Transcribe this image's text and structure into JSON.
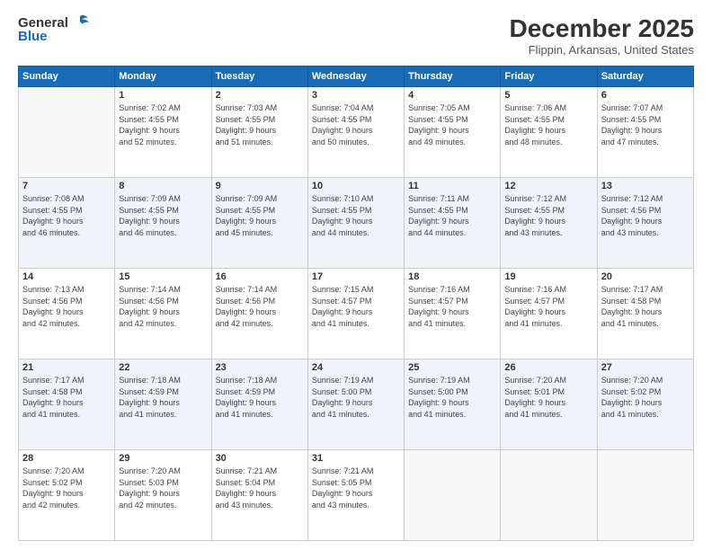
{
  "header": {
    "logo_line1": "General",
    "logo_line2": "Blue",
    "title": "December 2025",
    "subtitle": "Flippin, Arkansas, United States"
  },
  "calendar": {
    "days_of_week": [
      "Sunday",
      "Monday",
      "Tuesday",
      "Wednesday",
      "Thursday",
      "Friday",
      "Saturday"
    ],
    "weeks": [
      [
        {
          "day": "",
          "info": ""
        },
        {
          "day": "1",
          "info": "Sunrise: 7:02 AM\nSunset: 4:55 PM\nDaylight: 9 hours\nand 52 minutes."
        },
        {
          "day": "2",
          "info": "Sunrise: 7:03 AM\nSunset: 4:55 PM\nDaylight: 9 hours\nand 51 minutes."
        },
        {
          "day": "3",
          "info": "Sunrise: 7:04 AM\nSunset: 4:55 PM\nDaylight: 9 hours\nand 50 minutes."
        },
        {
          "day": "4",
          "info": "Sunrise: 7:05 AM\nSunset: 4:55 PM\nDaylight: 9 hours\nand 49 minutes."
        },
        {
          "day": "5",
          "info": "Sunrise: 7:06 AM\nSunset: 4:55 PM\nDaylight: 9 hours\nand 48 minutes."
        },
        {
          "day": "6",
          "info": "Sunrise: 7:07 AM\nSunset: 4:55 PM\nDaylight: 9 hours\nand 47 minutes."
        }
      ],
      [
        {
          "day": "7",
          "info": "Sunrise: 7:08 AM\nSunset: 4:55 PM\nDaylight: 9 hours\nand 46 minutes."
        },
        {
          "day": "8",
          "info": "Sunrise: 7:09 AM\nSunset: 4:55 PM\nDaylight: 9 hours\nand 46 minutes."
        },
        {
          "day": "9",
          "info": "Sunrise: 7:09 AM\nSunset: 4:55 PM\nDaylight: 9 hours\nand 45 minutes."
        },
        {
          "day": "10",
          "info": "Sunrise: 7:10 AM\nSunset: 4:55 PM\nDaylight: 9 hours\nand 44 minutes."
        },
        {
          "day": "11",
          "info": "Sunrise: 7:11 AM\nSunset: 4:55 PM\nDaylight: 9 hours\nand 44 minutes."
        },
        {
          "day": "12",
          "info": "Sunrise: 7:12 AM\nSunset: 4:55 PM\nDaylight: 9 hours\nand 43 minutes."
        },
        {
          "day": "13",
          "info": "Sunrise: 7:12 AM\nSunset: 4:56 PM\nDaylight: 9 hours\nand 43 minutes."
        }
      ],
      [
        {
          "day": "14",
          "info": "Sunrise: 7:13 AM\nSunset: 4:56 PM\nDaylight: 9 hours\nand 42 minutes."
        },
        {
          "day": "15",
          "info": "Sunrise: 7:14 AM\nSunset: 4:56 PM\nDaylight: 9 hours\nand 42 minutes."
        },
        {
          "day": "16",
          "info": "Sunrise: 7:14 AM\nSunset: 4:56 PM\nDaylight: 9 hours\nand 42 minutes."
        },
        {
          "day": "17",
          "info": "Sunrise: 7:15 AM\nSunset: 4:57 PM\nDaylight: 9 hours\nand 41 minutes."
        },
        {
          "day": "18",
          "info": "Sunrise: 7:16 AM\nSunset: 4:57 PM\nDaylight: 9 hours\nand 41 minutes."
        },
        {
          "day": "19",
          "info": "Sunrise: 7:16 AM\nSunset: 4:57 PM\nDaylight: 9 hours\nand 41 minutes."
        },
        {
          "day": "20",
          "info": "Sunrise: 7:17 AM\nSunset: 4:58 PM\nDaylight: 9 hours\nand 41 minutes."
        }
      ],
      [
        {
          "day": "21",
          "info": "Sunrise: 7:17 AM\nSunset: 4:58 PM\nDaylight: 9 hours\nand 41 minutes."
        },
        {
          "day": "22",
          "info": "Sunrise: 7:18 AM\nSunset: 4:59 PM\nDaylight: 9 hours\nand 41 minutes."
        },
        {
          "day": "23",
          "info": "Sunrise: 7:18 AM\nSunset: 4:59 PM\nDaylight: 9 hours\nand 41 minutes."
        },
        {
          "day": "24",
          "info": "Sunrise: 7:19 AM\nSunset: 5:00 PM\nDaylight: 9 hours\nand 41 minutes."
        },
        {
          "day": "25",
          "info": "Sunrise: 7:19 AM\nSunset: 5:00 PM\nDaylight: 9 hours\nand 41 minutes."
        },
        {
          "day": "26",
          "info": "Sunrise: 7:20 AM\nSunset: 5:01 PM\nDaylight: 9 hours\nand 41 minutes."
        },
        {
          "day": "27",
          "info": "Sunrise: 7:20 AM\nSunset: 5:02 PM\nDaylight: 9 hours\nand 41 minutes."
        }
      ],
      [
        {
          "day": "28",
          "info": "Sunrise: 7:20 AM\nSunset: 5:02 PM\nDaylight: 9 hours\nand 42 minutes."
        },
        {
          "day": "29",
          "info": "Sunrise: 7:20 AM\nSunset: 5:03 PM\nDaylight: 9 hours\nand 42 minutes."
        },
        {
          "day": "30",
          "info": "Sunrise: 7:21 AM\nSunset: 5:04 PM\nDaylight: 9 hours\nand 43 minutes."
        },
        {
          "day": "31",
          "info": "Sunrise: 7:21 AM\nSunset: 5:05 PM\nDaylight: 9 hours\nand 43 minutes."
        },
        {
          "day": "",
          "info": ""
        },
        {
          "day": "",
          "info": ""
        },
        {
          "day": "",
          "info": ""
        }
      ]
    ]
  }
}
